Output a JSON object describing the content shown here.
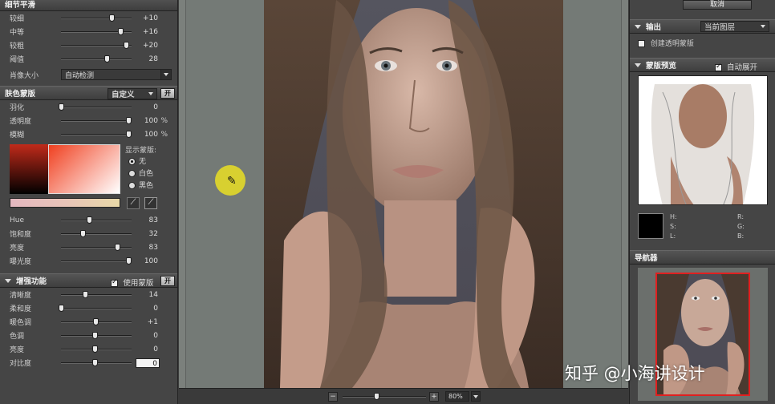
{
  "left": {
    "detail": {
      "title": "细节平滑",
      "sliders": [
        {
          "label": "较细",
          "value": "+10",
          "pos": 0.75
        },
        {
          "label": "中等",
          "value": "+16",
          "pos": 0.88
        },
        {
          "label": "较粗",
          "value": "+20",
          "pos": 0.97
        },
        {
          "label": "阈值",
          "value": "28",
          "pos": 0.68
        }
      ],
      "portrait_size_label": "肖像大小",
      "portrait_size_value": "自动检测"
    },
    "skin": {
      "title": "肤色蒙版",
      "mode_value": "自定义",
      "toggle_label": "开",
      "sliders": [
        {
          "label": "羽化",
          "value": "0",
          "unit": "",
          "pos": 0.0
        },
        {
          "label": "透明度",
          "value": "100",
          "unit": "%",
          "pos": 1.0
        },
        {
          "label": "模糊",
          "value": "100",
          "unit": "%",
          "pos": 1.0
        }
      ],
      "show_mask_label": "显示蒙版:",
      "radios": [
        {
          "label": "无",
          "selected": true
        },
        {
          "label": "白色",
          "selected": false
        },
        {
          "label": "黑色",
          "selected": false
        }
      ],
      "color_sliders": [
        {
          "label": "Hue",
          "value": "83",
          "pos": 0.42
        },
        {
          "label": "饱和度",
          "value": "32",
          "pos": 0.32
        },
        {
          "label": "亮度",
          "value": "83",
          "pos": 0.83
        },
        {
          "label": "曝光度",
          "value": "100",
          "pos": 1.0
        }
      ]
    },
    "enhance": {
      "title": "增强功能",
      "use_mask_label": "使用蒙版",
      "toggle_label": "开",
      "sliders": [
        {
          "label": "清晰度",
          "value": "14",
          "pos": 0.36
        },
        {
          "label": "柔和度",
          "value": "0",
          "pos": 0.0
        },
        {
          "label": "暖色调",
          "value": "+1",
          "pos": 0.51
        },
        {
          "label": "色调",
          "value": "0",
          "pos": 0.5
        },
        {
          "label": "亮度",
          "value": "0",
          "pos": 0.5
        },
        {
          "label": "对比度",
          "value": "0",
          "pos": 0.5
        }
      ]
    }
  },
  "center": {
    "zoom_minus": "−",
    "zoom_plus": "+",
    "zoom_value": "80%",
    "zoom_pos": 0.42
  },
  "right": {
    "cancel_label": "取消",
    "output": {
      "title": "输出",
      "target_value": "当前图层",
      "new_mask_label": "创建透明蒙版"
    },
    "mask_preview": {
      "title": "蒙版预览",
      "auto_expand_label": "自动展开",
      "h_label": "H:",
      "s_label": "S:",
      "l_label": "L:",
      "r_label": "R:",
      "g_label": "G:",
      "b_label": "B:"
    },
    "navigator": {
      "title": "导航器"
    }
  },
  "watermark": "知乎 @小海讲设计",
  "colors": {
    "panel": "#454545",
    "canvas_bg": "#7b807c",
    "navigator_frame": "#e02020",
    "cursor_highlight": "#d8d030"
  }
}
